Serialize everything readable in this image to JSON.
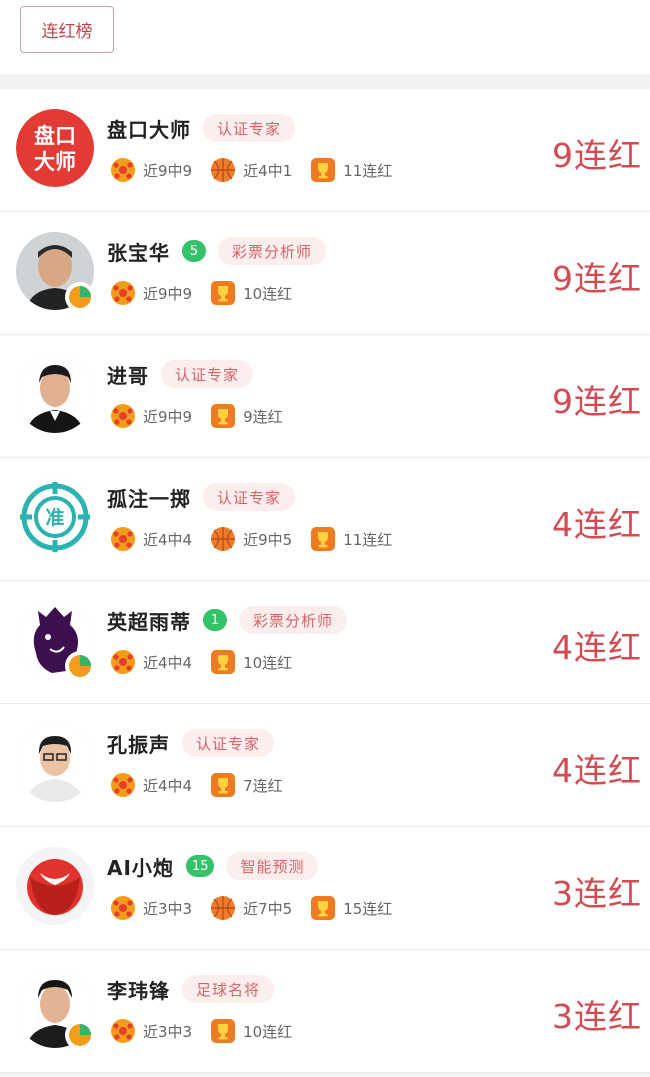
{
  "tab": {
    "label": "连红榜"
  },
  "colors": {
    "streak": "#d24b52",
    "tag_bg": "#fdeeee",
    "level": "#34c26b"
  },
  "rows": [
    {
      "name": "盘口大师",
      "level": "",
      "tag": "认证专家",
      "stats": [
        {
          "icon": "football-icon",
          "text": "近9中9"
        },
        {
          "icon": "basketball-icon",
          "text": "近4中1"
        },
        {
          "icon": "trophy-icon",
          "text": "11连红"
        }
      ],
      "streak": "9连红",
      "avatar_text_1": "盘口",
      "avatar_text_2": "大师"
    },
    {
      "name": "张宝华",
      "level": "5",
      "tag": "彩票分析师",
      "stats": [
        {
          "icon": "football-icon",
          "text": "近9中9"
        },
        {
          "icon": "trophy-icon",
          "text": "10连红"
        }
      ],
      "streak": "9连红"
    },
    {
      "name": "进哥",
      "level": "",
      "tag": "认证专家",
      "stats": [
        {
          "icon": "football-icon",
          "text": "近9中9"
        },
        {
          "icon": "trophy-icon",
          "text": "9连红"
        }
      ],
      "streak": "9连红"
    },
    {
      "name": "孤注一掷",
      "level": "",
      "tag": "认证专家",
      "stats": [
        {
          "icon": "football-icon",
          "text": "近4中4"
        },
        {
          "icon": "basketball-icon",
          "text": "近9中5"
        },
        {
          "icon": "trophy-icon",
          "text": "11连红"
        }
      ],
      "streak": "4连红",
      "avatar_text_1": "准"
    },
    {
      "name": "英超雨蒂",
      "level": "1",
      "tag": "彩票分析师",
      "stats": [
        {
          "icon": "football-icon",
          "text": "近4中4"
        },
        {
          "icon": "trophy-icon",
          "text": "10连红"
        }
      ],
      "streak": "4连红"
    },
    {
      "name": "孔振声",
      "level": "",
      "tag": "认证专家",
      "stats": [
        {
          "icon": "football-icon",
          "text": "近4中4"
        },
        {
          "icon": "trophy-icon",
          "text": "7连红"
        }
      ],
      "streak": "4连红"
    },
    {
      "name": "AI小炮",
      "level": "15",
      "tag": "智能预测",
      "stats": [
        {
          "icon": "football-icon",
          "text": "近3中3"
        },
        {
          "icon": "basketball-icon",
          "text": "近7中5"
        },
        {
          "icon": "trophy-icon",
          "text": "15连红"
        }
      ],
      "streak": "3连红"
    },
    {
      "name": "李玮锋",
      "level": "",
      "tag": "足球名将",
      "stats": [
        {
          "icon": "football-icon",
          "text": "近3中3"
        },
        {
          "icon": "trophy-icon",
          "text": "10连红"
        }
      ],
      "streak": "3连红"
    }
  ]
}
